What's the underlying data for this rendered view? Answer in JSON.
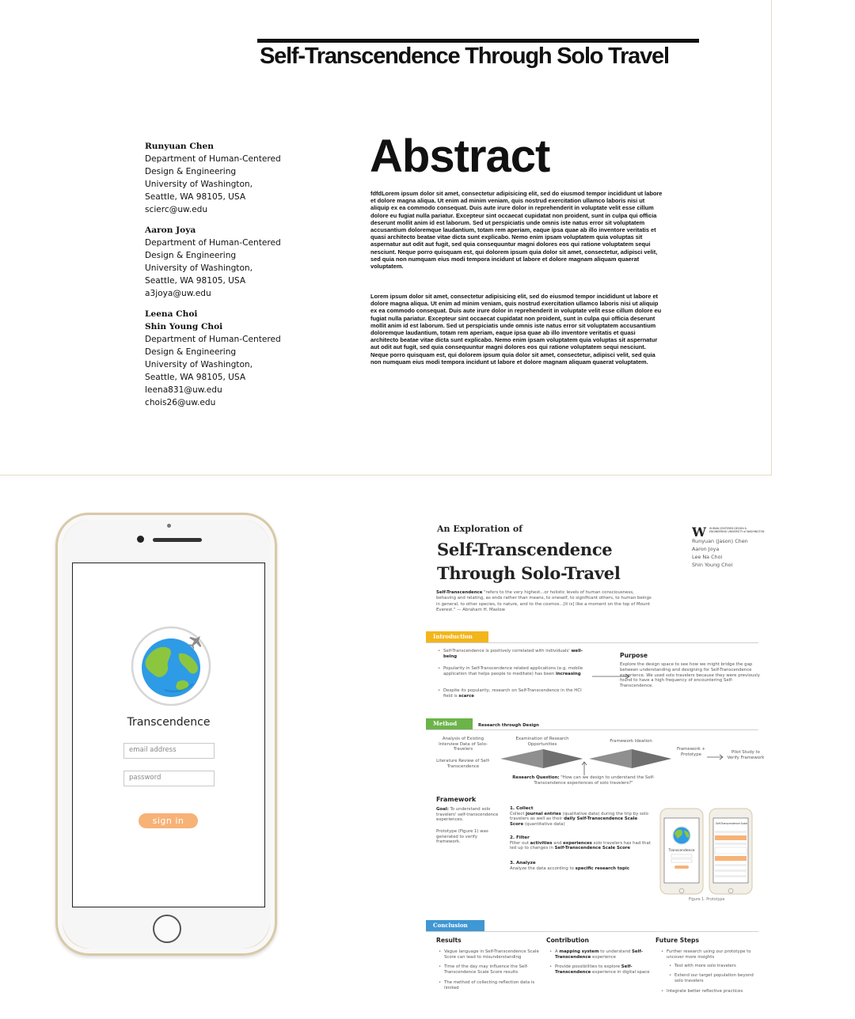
{
  "paper": {
    "title": "Self-Transcendence Through Solo Travel",
    "abstract_heading": "Abstract",
    "authors": [
      {
        "names": [
          "Runyuan Chen"
        ],
        "lines": [
          "Department of Human-Centered",
          "Design & Engineering",
          "University of Washington,",
          "Seattle, WA 98105, USA",
          "scierc@uw.edu"
        ]
      },
      {
        "names": [
          "Aaron Joya"
        ],
        "lines": [
          "Department of Human-Centered",
          "Design & Engineering",
          "University of Washington,",
          "Seattle, WA 98105, USA",
          "a3joya@uw.edu"
        ]
      },
      {
        "names": [
          "Leena Choi",
          "Shin Young Choi"
        ],
        "lines": [
          "Department of Human-Centered",
          "Design & Engineering",
          "University of Washington,",
          "Seattle, WA 98105, USA",
          "leena831@uw.edu",
          "chois26@uw.edu"
        ]
      }
    ],
    "abstract_p1": "fdfdLorem ipsum dolor sit amet, consectetur adipisicing elit, sed do eiusmod tempor incididunt ut labore et dolore magna aliqua. Ut enim ad minim veniam, quis nostrud exercitation ullamco laboris nisi ut aliquip ex ea commodo consequat. Duis aute irure dolor in reprehenderit in voluptate velit esse cillum dolore eu fugiat nulla pariatur. Excepteur sint occaecat cupidatat non proident, sunt in culpa qui officia deserunt mollit anim id est laborum. Sed ut perspiciatis unde omnis iste natus error sit voluptatem accusantium doloremque laudantium, totam rem aperiam, eaque ipsa quae ab illo inventore veritatis et quasi architecto beatae vitae dicta sunt explicabo. Nemo enim ipsam voluptatem quia voluptas sit aspernatur aut odit aut fugit, sed quia consequuntur magni dolores eos qui ratione voluptatem sequi nesciunt. Neque porro quisquam est, qui dolorem ipsum quia dolor sit amet, consectetur, adipisci velit, sed quia non numquam eius modi tempora incidunt ut labore et dolore magnam aliquam quaerat voluptatem.",
    "abstract_p2": "Lorem ipsum dolor sit amet, consectetur adipisicing elit, sed do eiusmod tempor incididunt ut labore et dolore magna aliqua. Ut enim ad minim veniam, quis nostrud exercitation ullamco laboris nisi ut aliquip ex ea commodo consequat. Duis aute irure dolor in reprehenderit in voluptate velit esse cillum dolore eu fugiat nulla pariatur. Excepteur sint occaecat cupidatat non proident, sunt in culpa qui officia deserunt mollit anim id est laborum. Sed ut perspiciatis unde omnis iste natus error sit voluptatem accusantium doloremque laudantium, totam rem aperiam, eaque ipsa quae ab illo inventore veritatis et quasi architecto beatae vitae dicta sunt explicabo. Nemo enim ipsam voluptatem quia voluptas sit aspernatur aut odit aut fugit, sed quia consequuntur magni dolores eos qui ratione voluptatem sequi nesciunt. Neque porro quisquam est, qui dolorem ipsum quia dolor sit amet, consectetur, adipisci velit, sed quia non numquam eius modi tempora incidunt ut labore et dolore magnam aliquam quaerat voluptatem."
  },
  "phone_app": {
    "app_name": "Transcendence",
    "email_placeholder": "email address",
    "password_placeholder": "password",
    "signin_label": "sign in",
    "icon": "globe-with-airplane-icon",
    "colors": {
      "accent": "#f7b277",
      "ocean": "#2e9be6",
      "land": "#8cc63f"
    }
  },
  "poster": {
    "kicker": "An Exploration of",
    "title": "Self-Transcendence Through Solo-Travel",
    "logo_letter": "W",
    "dept": "HUMAN CENTERED DESIGN & ENGINEERING UNIVERSITY of WASHINGTON",
    "authors": [
      "Runyuan (Jason) Chen",
      "Aaron Joya",
      "Lee Na Choi",
      "Shin Young Choi"
    ],
    "quote_term": "Self-Transcendence",
    "quote_text": " \"refers to the very highest...or holistic levels of human consciousness, behaving and relating, as ends rather than means, to oneself, to significant others, to human beings in general, to other species, to nature, and to the cosmos...[it is] like a moment on the top of Mount Everest.\"  — Abraham H. Maslow",
    "intro": {
      "tag": "Introduction",
      "color": "#f3b51c",
      "b1": "Self-Transcendence is positively correlated with individuals'",
      "b1_bold": "well-being",
      "b2": "Popularity in Self-Transcendence related applications (e.g. mobile application that helps people to meditate) has been",
      "b2_bold": "increasing",
      "b3": "Despite its popularity, research on Self-Transcendence in the HCI field is",
      "b3_bold": "scarce",
      "purpose_head": "Purpose",
      "purpose_text": "Explore the design space to see how we might bridge the gap between understanding and designing for Self-Transcendence experience. We used solo travelers because they were previously found to have a high frequency of encountering Self-Transcendence."
    },
    "method": {
      "tag": "Method",
      "color": "#6cb34a",
      "subtitle": "Research through Design",
      "analysis": "Analysis of Existing Interview Data of Solo-Travelers",
      "literature": "Literature Review of Self-Transcendence",
      "examination": "Examination of Research Opportunities",
      "ideation": "Framework Ideation",
      "framework_prototype": "Framework + Prototype",
      "pilot": "Pilot Study to Verify Framework",
      "rq_label": "Research Question:",
      "rq_text": " \"How can we design to understand the Self-Transcendence experiences of solo travelers?\""
    },
    "framework": {
      "head": "Framework",
      "goal_label": "Goal:",
      "goal_text": " To understand solo travelers' self-transcendence experiences.",
      "prototype_text": "Prototype (Figure 1) was generated to verify framework.",
      "s1_title": "1. Collect",
      "s1_pre": "Collect ",
      "s1_b1": "journal entries",
      "s1_mid": " (qualitative data) during the trip by solo travelers as well as their ",
      "s1_b2": "daily Self-Transcendence Scale Score",
      "s1_post": " (quantitative data)",
      "s2_title": "2. Filter",
      "s2_pre": "Filter out ",
      "s2_b1": "activities",
      "s2_mid": " and ",
      "s2_b2": "experiences",
      "s2_mid2": " solo travelers has had that led up to changes in ",
      "s2_b3": "Self-Transcendence Scale Score",
      "s3_title": "3. Analyze",
      "s3_pre": "Analyze the data according to ",
      "s3_b1": "specific research topic",
      "fig_caption": "Figure 1. Prototype",
      "mini_app_name": "Transcendence",
      "mini_scale_title": "Self-Transcendence Scale"
    },
    "conclusion": {
      "tag": "Conclusion",
      "color": "#3f97d3",
      "results_head": "Results",
      "r1": "Vague language in Self-Transcendence Scale Score can lead to misunderstanding",
      "r2": "Time of the day may influence the Self-Transcendence Scale Score results",
      "r3": "The method of collecting reflection data is limited",
      "contrib_head": "Contribution",
      "c1_pre": "A ",
      "c1_b": "mapping system",
      "c1_mid": " to understand ",
      "c1_b2": "Self-Transcendence",
      "c1_post": " experience",
      "c2_pre": "Provide possibilities to explore ",
      "c2_b": "Self-Transcendence",
      "c2_post": " experience in digital space",
      "future_head": "Future Steps",
      "f1": "Further research using our prototype to uncover more insights",
      "f2": "Test with more solo travelers",
      "f3": "Extend our target population beyond solo travelers",
      "f4": "Integrate better reflective practices"
    }
  }
}
